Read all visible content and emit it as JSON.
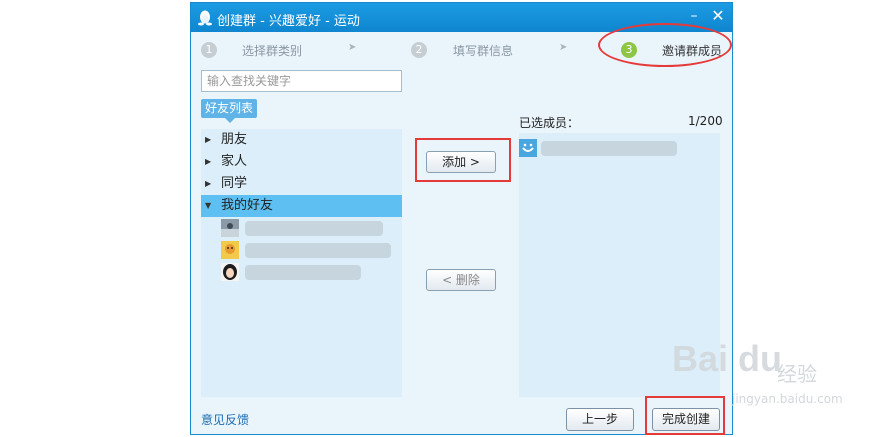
{
  "window": {
    "title": "创建群 - 兴趣爱好 - 运动",
    "min_glyph": "–",
    "close_glyph": "✕"
  },
  "steps": [
    {
      "num": "1",
      "label": "选择群类别",
      "active": false
    },
    {
      "num": "2",
      "label": "填写群信息",
      "active": false
    },
    {
      "num": "3",
      "label": "邀请群成员",
      "active": true
    }
  ],
  "step_arrow": "➤",
  "search": {
    "placeholder": "输入查找关键字",
    "value": ""
  },
  "friend_tab": "好友列表",
  "groups": [
    {
      "label": "朋友",
      "expanded": false
    },
    {
      "label": "家人",
      "expanded": false
    },
    {
      "label": "同学",
      "expanded": false
    },
    {
      "label": "我的好友",
      "expanded": true
    }
  ],
  "arrows": {
    "collapsed": "▶",
    "expanded": "▼"
  },
  "buttons": {
    "add": "添加 >",
    "delete": "< 删除",
    "prev": "上一步",
    "finish": "完成创建"
  },
  "selected": {
    "label": "已选成员：",
    "count": "1/200"
  },
  "feedback": "意见反馈",
  "watermark": {
    "logo": "Bai du",
    "cn": "经验",
    "url": "jingyan.baidu.com"
  },
  "colors": {
    "titlebar": "#0f86cf",
    "selected_row": "#5ec0f2",
    "panel": "#dbeefa",
    "active_step": "#8ec542",
    "highlight": "#e53a3a"
  }
}
